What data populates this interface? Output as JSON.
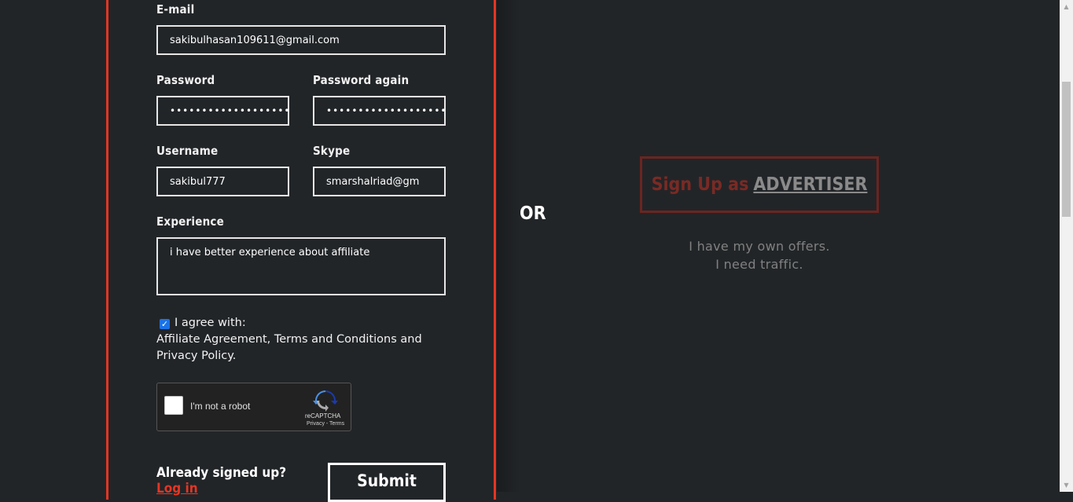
{
  "form": {
    "email_label": "E-mail",
    "email_value": "sakibulhasan109611@gmail.com",
    "password_label": "Password",
    "password_value": "•••••••••••••••••••",
    "password_again_label": "Password again",
    "password_again_value": "•••••••••••••••••••",
    "username_label": "Username",
    "username_value": "sakibul777",
    "skype_label": "Skype",
    "skype_value": "smarshalriad@gm",
    "experience_label": "Experience",
    "experience_value": "i have better experience about affiliate",
    "agree_text": "I agree with:",
    "agree_links": "Affiliate Agreement, Terms and Conditions and Privacy Policy.",
    "agree_checked": true
  },
  "recaptcha": {
    "label": "I'm not a robot",
    "brand": "reCAPTCHA",
    "links": "Privacy - Terms"
  },
  "footer": {
    "already_text": "Already signed up?",
    "login_link": "Log in",
    "submit_label": "Submit"
  },
  "divider": {
    "or_text": "OR"
  },
  "advertiser": {
    "prefix": "Sign Up as",
    "link": "ADVERTISER",
    "desc_line1": "I have my own offers.",
    "desc_line2": "I need traffic."
  },
  "colors": {
    "accent": "#e53523",
    "background": "#222528",
    "muted_red": "#6b2521"
  }
}
